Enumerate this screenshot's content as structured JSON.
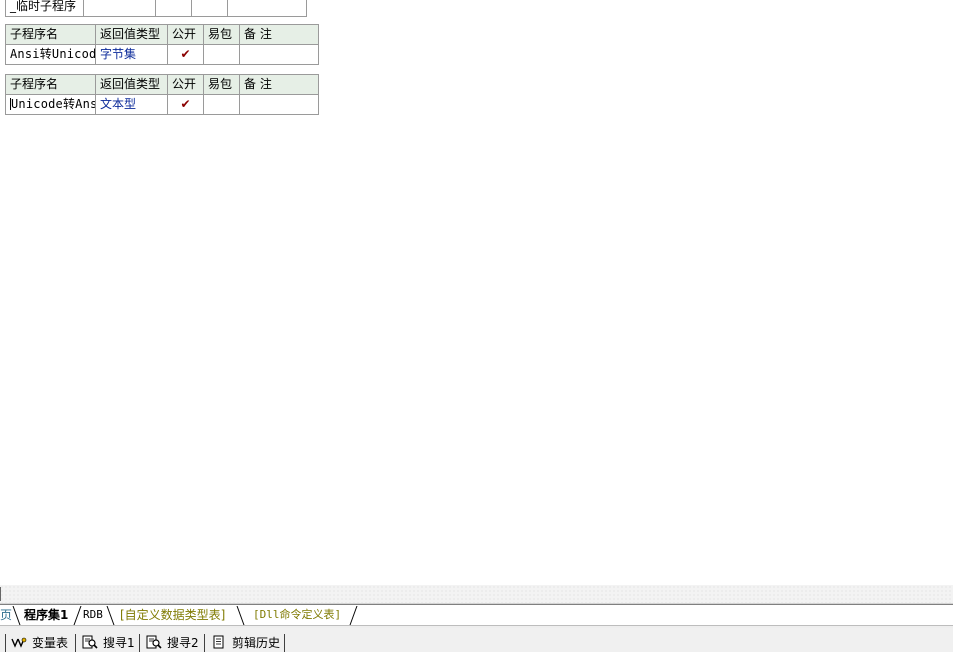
{
  "tables": [
    {
      "partial": true,
      "rows": [
        [
          "_临时子程序",
          "",
          "",
          "",
          ""
        ]
      ]
    },
    {
      "headers": [
        "子程序名",
        "返回值类型",
        "公开",
        "易包",
        "备 注"
      ],
      "rows": [
        [
          "Ansi转Unicode",
          "字节集",
          "✔",
          "",
          ""
        ]
      ]
    },
    {
      "headers": [
        "子程序名",
        "返回值类型",
        "公开",
        "易包",
        "备 注"
      ],
      "rows": [
        [
          "Unicode转Ansi",
          "文本型",
          "✔",
          "",
          ""
        ]
      ]
    }
  ],
  "tabs": [
    {
      "label": "页"
    },
    {
      "label": "程序集1",
      "active": true
    },
    {
      "label": "RDB"
    },
    {
      "label": "[自定义数据类型表]"
    },
    {
      "label": "[Dll命令定义表]"
    }
  ],
  "toolbar": [
    {
      "label": "变量表",
      "icon": "variable-table-icon"
    },
    {
      "label": "搜寻1",
      "icon": "search-1-icon"
    },
    {
      "label": "搜寻2",
      "icon": "search-2-icon"
    },
    {
      "label": "剪辑历史",
      "icon": "clipboard-history-icon"
    }
  ],
  "colors": {
    "header_bg": "#e6efe6",
    "type_text": "#0b2a9a",
    "check": "#8a0000",
    "tab_olive": "#7f7a00"
  }
}
